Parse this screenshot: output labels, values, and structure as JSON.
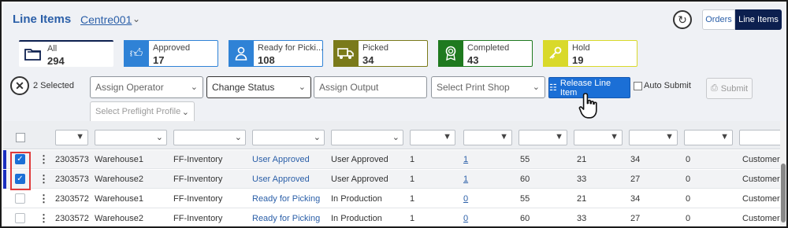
{
  "header": {
    "title": "Line Items",
    "centre": "Centre001",
    "view_toggle": {
      "orders": "Orders",
      "line_items": "Line Items"
    }
  },
  "status_cards": [
    {
      "key": "all",
      "label": "All",
      "count": "294",
      "color": "#0c1f4f",
      "icon": "folder-icon"
    },
    {
      "key": "approved",
      "label": "Approved",
      "count": "17",
      "color": "#2f82d6",
      "icon": "thumbs-up-icon"
    },
    {
      "key": "ready",
      "label": "Ready for Picki...",
      "count": "108",
      "color": "#2f82d6",
      "icon": "user-icon"
    },
    {
      "key": "picked",
      "label": "Picked",
      "count": "34",
      "color": "#7a7a1a",
      "icon": "truck-icon"
    },
    {
      "key": "completed",
      "label": "Completed",
      "count": "43",
      "color": "#1f7a1f",
      "icon": "award-icon"
    },
    {
      "key": "hold",
      "label": "Hold",
      "count": "19",
      "color": "#d9d92a",
      "icon": "key-icon"
    }
  ],
  "actions": {
    "selected_text": "2 Selected",
    "assign_operator": "Assign Operator",
    "change_status": "Change Status",
    "assign_output": "Assign Output",
    "select_print_shop": "Select Print Shop",
    "release_label": "Release Line Item",
    "auto_submit": "Auto Submit",
    "submit": "Submit",
    "preflight": "Select Preflight Profile"
  },
  "rows": [
    {
      "checked": true,
      "id": "2303573",
      "warehouse": "Warehouse1",
      "inventory": "FF-Inventory",
      "status_link": "User Approved",
      "status": "User Approved",
      "qty": "1",
      "link_count": "1",
      "a": "55",
      "b": "21",
      "c": "34",
      "d": "0",
      "customer": "Customer Pic"
    },
    {
      "checked": true,
      "id": "2303573",
      "warehouse": "Warehouse2",
      "inventory": "FF-Inventory",
      "status_link": "User Approved",
      "status": "User Approved",
      "qty": "1",
      "link_count": "1",
      "a": "60",
      "b": "33",
      "c": "27",
      "d": "0",
      "customer": "Customer Pic"
    },
    {
      "checked": false,
      "id": "2303572",
      "warehouse": "Warehouse1",
      "inventory": "FF-Inventory",
      "status_link": "Ready for Picking",
      "status": "In Production",
      "qty": "1",
      "link_count": "0",
      "a": "55",
      "b": "21",
      "c": "34",
      "d": "0",
      "customer": "Customer Pic"
    },
    {
      "checked": false,
      "id": "2303572",
      "warehouse": "Warehouse2",
      "inventory": "FF-Inventory",
      "status_link": "Ready for Picking",
      "status": "In Production",
      "qty": "1",
      "link_count": "0",
      "a": "60",
      "b": "33",
      "c": "27",
      "d": "0",
      "customer": "Customer Pic"
    }
  ]
}
